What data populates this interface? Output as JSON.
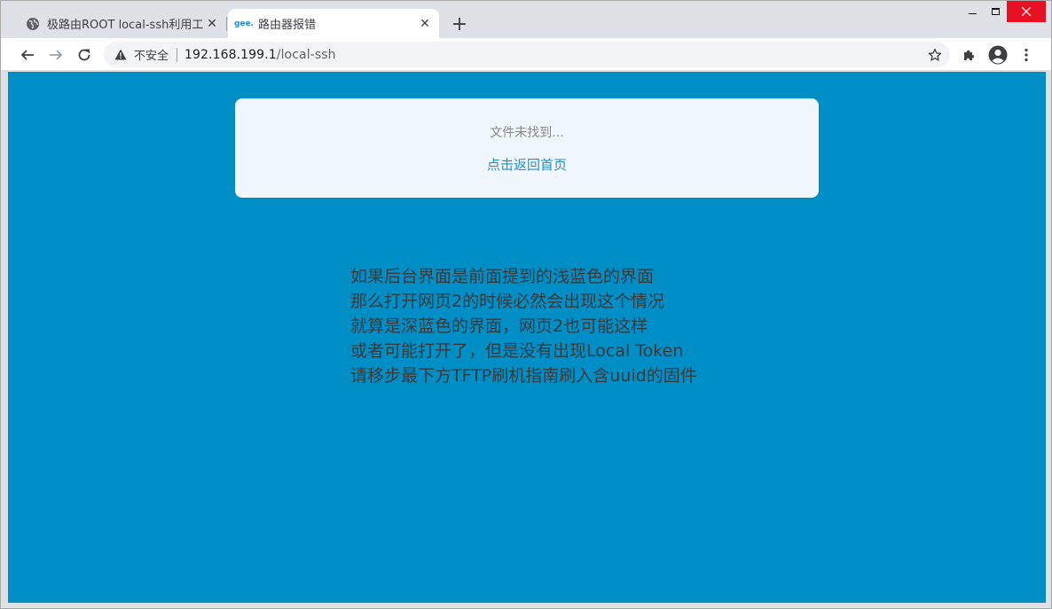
{
  "browser": {
    "tabs": [
      {
        "title": "极路由ROOT local-ssh利用工具",
        "favicon": "globe-icon",
        "active": false
      },
      {
        "title": "路由器报错",
        "favicon": "gee-logo-icon",
        "favicon_text": "gee.",
        "active": true
      }
    ],
    "new_tab_label": "+",
    "toolbar": {
      "security_label": "不安全",
      "url_host": "192.168.199.1",
      "url_path": "/local-ssh"
    }
  },
  "page": {
    "error_message": "文件未找到...",
    "home_link": "点击返回首页",
    "note_lines": [
      "如果后台界面是前面提到的浅蓝色的界面",
      "那么打开网页2的时候必然会出现这个情况",
      "就算是深蓝色的界面，网页2也可能这样",
      "或者可能打开了，但是没有出现Local Token",
      "请移步最下方TFTP刷机指南刷入含uuid的固件"
    ]
  },
  "colors": {
    "page_background": "#008ec6",
    "card_background": "#eff7fc",
    "link": "#1e90c8",
    "note_text": "#3a3a3a"
  }
}
